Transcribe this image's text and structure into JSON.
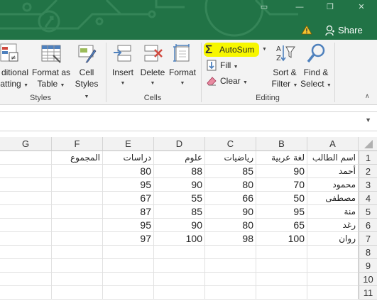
{
  "titlebar": {
    "share_label": "Share"
  },
  "ribbon": {
    "styles_group": {
      "label": "Styles",
      "conditional_label_1": "ditional",
      "conditional_label_2": "atting",
      "format_as_table_1": "Format as",
      "format_as_table_2": "Table",
      "cell_styles_1": "Cell",
      "cell_styles_2": "Styles"
    },
    "cells_group": {
      "label": "Cells",
      "insert": "Insert",
      "delete": "Delete",
      "format": "Format"
    },
    "editing_group": {
      "label": "Editing",
      "autosum": "AutoSum",
      "fill": "Fill",
      "clear": "Clear",
      "sort_filter_1": "Sort &",
      "sort_filter_2": "Filter",
      "find_select_1": "Find &",
      "find_select_2": "Select"
    }
  },
  "sheet": {
    "columns": [
      "A",
      "B",
      "C",
      "D",
      "E",
      "F",
      "G"
    ],
    "rows": [
      "1",
      "2",
      "3",
      "4",
      "5",
      "6",
      "7",
      "8",
      "9",
      "10",
      "11"
    ],
    "header_row": [
      "اسم الطالب",
      "لغة عربية",
      "رياضيات",
      "علوم",
      "دراسات",
      "المجموع"
    ],
    "data": [
      [
        "أحمد",
        "90",
        "85",
        "88",
        "80"
      ],
      [
        "محمود",
        "70",
        "80",
        "90",
        "95"
      ],
      [
        "مصطفى",
        "50",
        "66",
        "55",
        "67"
      ],
      [
        "منة",
        "95",
        "90",
        "85",
        "87"
      ],
      [
        "رغد",
        "65",
        "80",
        "90",
        "95"
      ],
      [
        "روان",
        "100",
        "98",
        "100",
        "97"
      ]
    ]
  },
  "colors": {
    "title_green": "#217346",
    "autosum_highlight": "#f7f700"
  }
}
